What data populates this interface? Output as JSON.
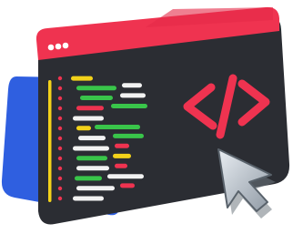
{
  "illustration": {
    "subject": "code-editor-window-icon",
    "symbol_text": "</>",
    "colors": {
      "back_panel": "#2f5fe0",
      "window_body": "#2b2d33",
      "title_bar": "#ef3350",
      "title_dots": "#ffffff",
      "symbol": "#ef3350",
      "gutter_bar": "#f3d21a",
      "line_markers": "#ef3350",
      "code_green": "#39c54a",
      "code_white": "#f2f2f2",
      "code_red": "#ef3350",
      "code_yellow": "#f3d21a",
      "cursor": "#b8c0c8"
    },
    "code_lines": [
      [
        "yellow"
      ],
      [
        "green",
        "white"
      ],
      [
        "green",
        "white"
      ],
      [
        "red",
        "green"
      ],
      [
        "white"
      ],
      [
        "yellow",
        "green"
      ],
      [
        "white",
        "green"
      ],
      [
        "white",
        "red"
      ],
      [
        "green",
        "yellow"
      ],
      [
        "white",
        "red"
      ],
      [
        "green",
        "white"
      ],
      [
        "white",
        "red"
      ],
      [
        "white"
      ]
    ]
  }
}
